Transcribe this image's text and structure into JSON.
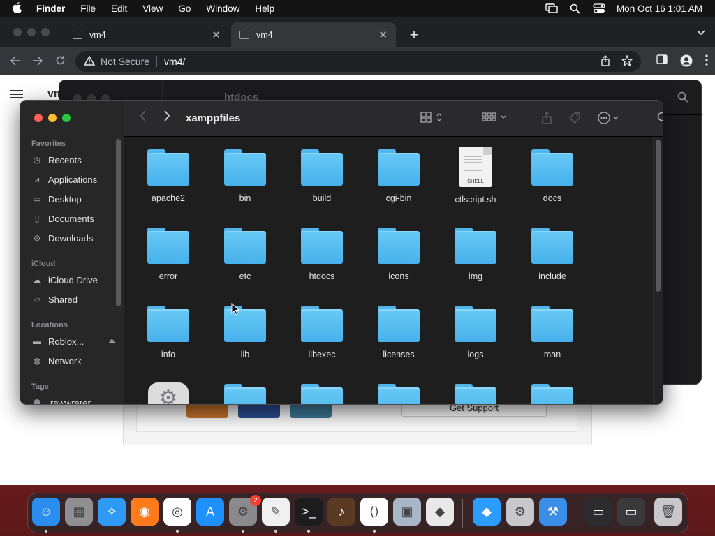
{
  "menubar": {
    "app_name": "Finder",
    "items": [
      "File",
      "Edit",
      "View",
      "Go",
      "Window",
      "Help"
    ],
    "clock": "Mon Oct 16  1:01 AM"
  },
  "browser": {
    "tabs": [
      {
        "label": "vm4"
      },
      {
        "label": "vm4"
      }
    ],
    "new_tab": "+",
    "security_label": "Not Secure",
    "url": "vm4/",
    "page_title": "vm",
    "get_support": "Get Support"
  },
  "finder_back": {
    "title": "htdocs"
  },
  "finder": {
    "title": "xamppfiles",
    "sidebar": {
      "favorites_heading": "Favorites",
      "favorites": [
        {
          "label": "Recents",
          "icon": "clock-icon"
        },
        {
          "label": "Applications",
          "icon": "applications-icon"
        },
        {
          "label": "Desktop",
          "icon": "desktop-icon"
        },
        {
          "label": "Documents",
          "icon": "document-icon"
        },
        {
          "label": "Downloads",
          "icon": "download-icon"
        }
      ],
      "icloud_heading": "iCloud",
      "icloud": [
        {
          "label": "iCloud Drive",
          "icon": "cloud-icon"
        },
        {
          "label": "Shared",
          "icon": "shared-folder-icon"
        }
      ],
      "locations_heading": "Locations",
      "locations": [
        {
          "label": "Roblox...",
          "icon": "disk-icon"
        },
        {
          "label": "Network",
          "icon": "network-icon"
        }
      ],
      "tags_heading": "Tags",
      "tags": [
        {
          "label": "rewwrerer"
        }
      ]
    },
    "items": [
      {
        "name": "apache2",
        "kind": "folder"
      },
      {
        "name": "bin",
        "kind": "folder"
      },
      {
        "name": "build",
        "kind": "folder"
      },
      {
        "name": "cgi-bin",
        "kind": "folder"
      },
      {
        "name": "ctlscript.sh",
        "kind": "shell"
      },
      {
        "name": "docs",
        "kind": "folder"
      },
      {
        "name": "error",
        "kind": "folder"
      },
      {
        "name": "etc",
        "kind": "folder"
      },
      {
        "name": "htdocs",
        "kind": "folder"
      },
      {
        "name": "icons",
        "kind": "folder"
      },
      {
        "name": "img",
        "kind": "folder"
      },
      {
        "name": "include",
        "kind": "folder"
      },
      {
        "name": "info",
        "kind": "folder"
      },
      {
        "name": "lib",
        "kind": "folder"
      },
      {
        "name": "libexec",
        "kind": "folder"
      },
      {
        "name": "licenses",
        "kind": "folder"
      },
      {
        "name": "logs",
        "kind": "folder"
      },
      {
        "name": "man",
        "kind": "folder"
      },
      {
        "name": "",
        "kind": "app"
      },
      {
        "name": "",
        "kind": "folder"
      },
      {
        "name": "",
        "kind": "folder"
      },
      {
        "name": "",
        "kind": "folder"
      },
      {
        "name": "",
        "kind": "folder"
      },
      {
        "name": "",
        "kind": "folder"
      }
    ],
    "shell_label": "SHELL"
  },
  "dock": {
    "apps": [
      {
        "name": "Finder",
        "icon": "finder-icon",
        "color": "#2b8df0",
        "running": true
      },
      {
        "name": "Launchpad",
        "icon": "launchpad-icon",
        "color": "#8e8e93",
        "running": false
      },
      {
        "name": "Safari",
        "icon": "safari-icon",
        "color": "#2f9af5",
        "running": false
      },
      {
        "name": "Firefox",
        "icon": "firefox-icon",
        "color": "#ff7a1a",
        "running": false
      },
      {
        "name": "Chrome",
        "icon": "chrome-icon",
        "color": "#ffffff",
        "running": true
      },
      {
        "name": "App Store",
        "icon": "app-store-icon",
        "color": "#1e90ff",
        "running": false
      },
      {
        "name": "System Settings",
        "icon": "settings-icon",
        "color": "#8a8a8e",
        "running": true,
        "badge": "2"
      },
      {
        "name": "TextEdit",
        "icon": "textedit-icon",
        "color": "#f0f0f0",
        "running": true
      },
      {
        "name": "Terminal",
        "icon": "terminal-icon",
        "color": "#1c1c1e",
        "running": true
      },
      {
        "name": "Instruments",
        "icon": "guitar-icon",
        "color": "#5a3a22",
        "running": false
      },
      {
        "name": "VS Code",
        "icon": "vscode-icon",
        "color": "#ffffff",
        "running": true
      },
      {
        "name": "VirtualBox",
        "icon": "virtualbox-icon",
        "color": "#a8b7c8",
        "running": false
      },
      {
        "name": "Roblox",
        "icon": "roblox-icon",
        "color": "#e9e9e9",
        "running": false
      },
      {
        "name": "Roblox Studio",
        "icon": "roblox-studio-icon",
        "color": "#2c9cff",
        "running": false
      },
      {
        "name": "Settings 2",
        "icon": "gear-icon",
        "color": "#c7c7cc",
        "running": false
      },
      {
        "name": "Xcode",
        "icon": "xcode-icon",
        "color": "#3b8ee8",
        "running": false
      },
      {
        "name": "Recent 1",
        "icon": "window-thumb-icon",
        "color": "#2c2c2e",
        "running": false
      },
      {
        "name": "Recent 2",
        "icon": "window-thumb-icon",
        "color": "#3a3a3c",
        "running": false
      },
      {
        "name": "Trash",
        "icon": "trash-icon",
        "color": "#c7c7cc",
        "running": false
      }
    ]
  }
}
